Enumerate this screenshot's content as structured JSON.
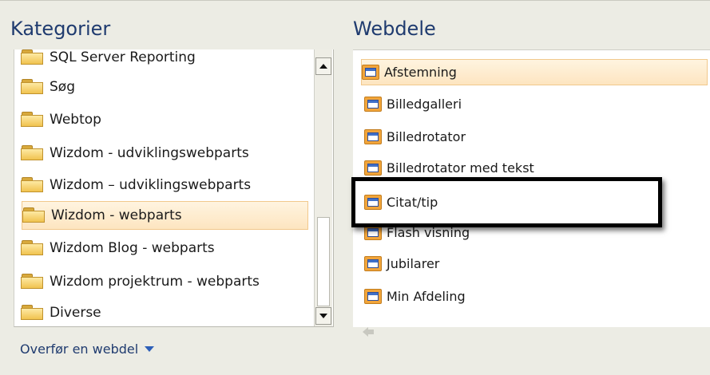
{
  "left": {
    "title": "Kategorier",
    "items": [
      {
        "label": "SQL Server Reporting",
        "selected": false
      },
      {
        "label": "Søg",
        "selected": false
      },
      {
        "label": "Webtop",
        "selected": false
      },
      {
        "label": "Wizdom - udviklingswebparts",
        "selected": false
      },
      {
        "label": "Wizdom – udviklingswebparts",
        "selected": false
      },
      {
        "label": "Wizdom - webparts",
        "selected": true
      },
      {
        "label": "Wizdom Blog - webparts",
        "selected": false
      },
      {
        "label": "Wizdom projektrum - webparts",
        "selected": false
      },
      {
        "label": "Diverse",
        "selected": false
      }
    ],
    "transfer_label": "Overfør en webdel"
  },
  "right": {
    "title": "Webdele",
    "items": [
      {
        "label": "Afstemning",
        "selected": true
      },
      {
        "label": "Billedgalleri",
        "selected": false
      },
      {
        "label": "Billedrotator",
        "selected": false
      },
      {
        "label": "Billedrotator med tekst",
        "selected": false
      },
      {
        "label": "Citat/tip",
        "selected": false
      },
      {
        "label": "Flash visning",
        "selected": false
      },
      {
        "label": "Jubilarer",
        "selected": false
      },
      {
        "label": "Min Afdeling",
        "selected": false
      }
    ]
  },
  "colors": {
    "accent": "#1f3b6f",
    "selection": "#fde5c0",
    "highlight_border": "#000000"
  }
}
